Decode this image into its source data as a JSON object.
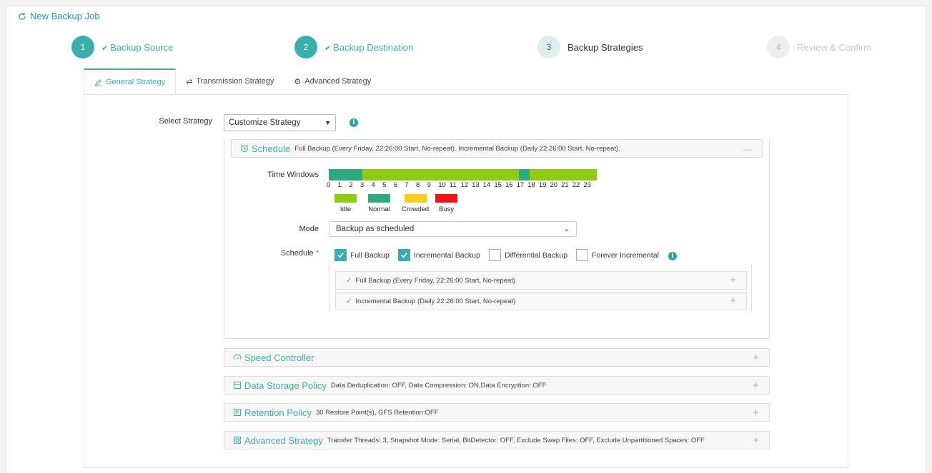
{
  "header": {
    "title": "New Backup Job"
  },
  "steps": [
    {
      "num": "1",
      "label": "Backup Source",
      "state": "done"
    },
    {
      "num": "2",
      "label": "Backup Destination",
      "state": "done"
    },
    {
      "num": "3",
      "label": "Backup Strategies",
      "state": "active"
    },
    {
      "num": "4",
      "label": "Review & Confirm",
      "state": "future"
    }
  ],
  "tabs": [
    {
      "label": "General Strategy",
      "active": true
    },
    {
      "label": "Transmission Strategy",
      "active": false
    },
    {
      "label": "Advanced Strategy",
      "active": false
    }
  ],
  "strategy": {
    "label": "Select Strategy",
    "value": "Customize Strategy"
  },
  "schedule_section": {
    "title": "Schedule",
    "summary": "Full Backup (Every Friday, 22:26:00 Start, No-repeat). Incremental Backup (Daily 22:26:00 Start, No-repeat).",
    "toggle": "—"
  },
  "time_windows": {
    "label": "Time Windows",
    "hours": [
      "0",
      "1",
      "2",
      "3",
      "4",
      "5",
      "6",
      "7",
      "8",
      "9",
      "10",
      "11",
      "12",
      "13",
      "14",
      "15",
      "16",
      "17",
      "18",
      "19",
      "20",
      "21",
      "22",
      "23"
    ],
    "states": [
      "normal",
      "normal",
      "normal",
      "idle",
      "idle",
      "idle",
      "idle",
      "idle",
      "idle",
      "idle",
      "idle",
      "idle",
      "idle",
      "idle",
      "idle",
      "idle",
      "idle",
      "normal",
      "idle",
      "idle",
      "idle",
      "idle",
      "idle",
      "idle"
    ],
    "legend": [
      {
        "label": "Idle",
        "color": "#8ecb13"
      },
      {
        "label": "Normal",
        "color": "#2faa7c"
      },
      {
        "label": "Crowded",
        "color": "#f5cf17"
      },
      {
        "label": "Busy",
        "color": "#f0141a"
      }
    ]
  },
  "mode": {
    "label": "Mode",
    "value": "Backup as scheduled"
  },
  "schedule": {
    "label": "Schedule",
    "required_mark": "*",
    "options": [
      {
        "label": "Full Backup",
        "checked": true
      },
      {
        "label": "Incremental Backup",
        "checked": true
      },
      {
        "label": "Differential Backup",
        "checked": false
      },
      {
        "label": "Forever Incremental",
        "checked": false
      }
    ],
    "items": [
      {
        "label": "Full Backup (Every Friday, 22:26:00 Start, No-repeat)"
      },
      {
        "label": "Incremental Backup (Daily 22:26:00 Start, No-repeat)"
      }
    ]
  },
  "sections": [
    {
      "title": "Speed Controller",
      "summary": "",
      "icon": "gauge-icon"
    },
    {
      "title": "Data Storage Policy",
      "summary": "Data Deduplication: OFF, Data Compression: ON,Data Encryption: OFF",
      "icon": "storage-icon"
    },
    {
      "title": "Retention Policy",
      "summary": "30 Restore Point(s), GFS Retention:OFF",
      "icon": "retention-icon"
    },
    {
      "title": "Advanced Strategy",
      "summary": "Transfer Threads: 3, Snapshot Mode: Serial, BitDetector: OFF, Exclude Swap Files: OFF, Exclude Unpartitioned Spaces: OFF",
      "icon": "grid-icon"
    }
  ],
  "colors": {
    "accent": "#3aaeaa",
    "link": "#2a8fbd",
    "idle": "#8ecb13",
    "normal": "#2faa7c"
  },
  "plus": "+"
}
